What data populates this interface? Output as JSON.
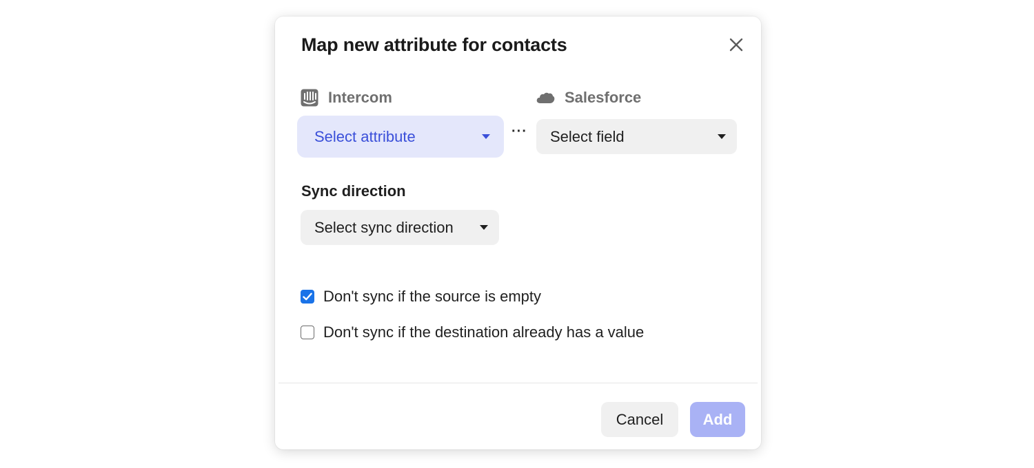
{
  "modal": {
    "title": "Map new attribute for contacts",
    "close_icon": "close-icon"
  },
  "mapping": {
    "source": {
      "name": "Intercom",
      "icon": "intercom-logo-icon",
      "select_value": "Select attribute"
    },
    "connector": "···",
    "destination": {
      "name": "Salesforce",
      "icon": "salesforce-cloud-icon",
      "select_value": "Select field"
    }
  },
  "sync": {
    "label": "Sync direction",
    "select_value": "Select sync direction"
  },
  "options": [
    {
      "label": "Don't sync if the source is empty",
      "checked": true
    },
    {
      "label": "Don't sync if the destination already has a value",
      "checked": false
    }
  ],
  "footer": {
    "cancel_label": "Cancel",
    "add_label": "Add"
  },
  "colors": {
    "accent": "#3a4fd9",
    "accent_light_bg": "#e4e7fb",
    "checkbox_checked": "#1a73e8",
    "add_button_disabled": "#a9b2f5"
  }
}
